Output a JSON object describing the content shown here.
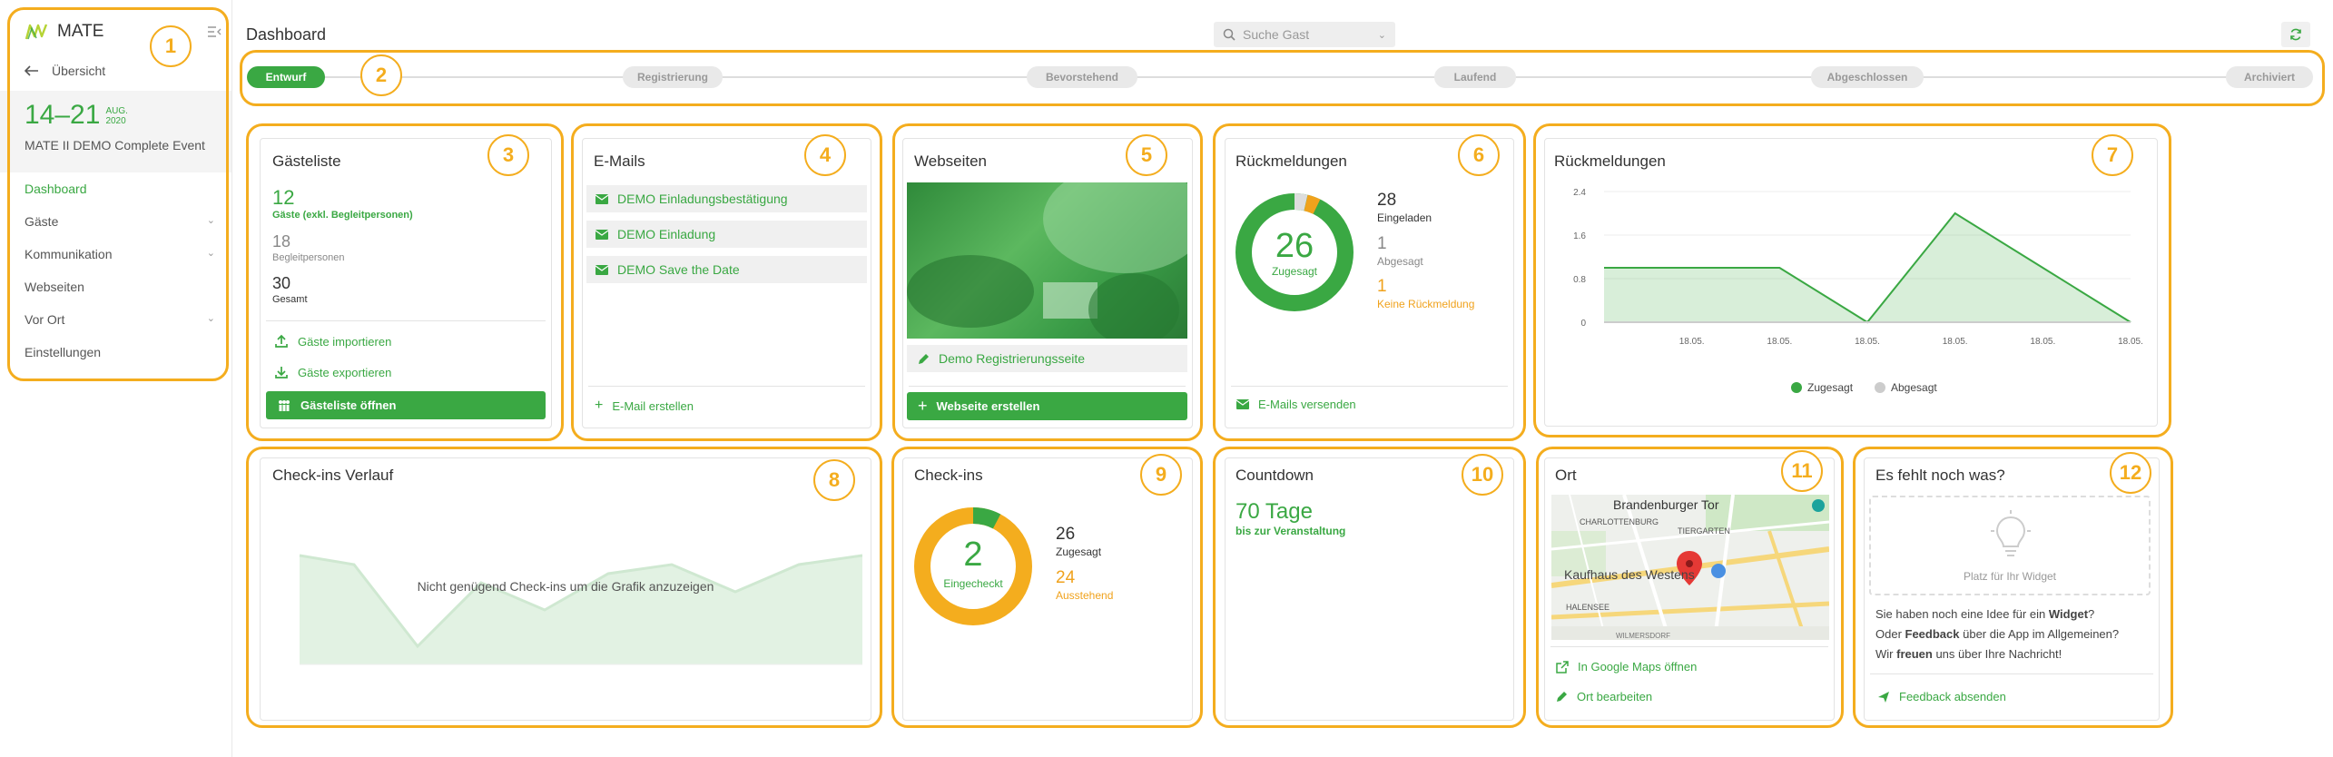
{
  "sidebar": {
    "logo_text": "MATE",
    "back_label": "Übersicht",
    "date_range": "14–21",
    "date_month": "AUG.",
    "date_year": "2020",
    "event_name": "MATE II DEMO Complete Event",
    "nav": [
      {
        "label": "Dashboard",
        "active": true,
        "expandable": false
      },
      {
        "label": "Gäste",
        "active": false,
        "expandable": true
      },
      {
        "label": "Kommunikation",
        "active": false,
        "expandable": true
      },
      {
        "label": "Webseiten",
        "active": false,
        "expandable": false
      },
      {
        "label": "Vor Ort",
        "active": false,
        "expandable": true
      },
      {
        "label": "Einstellungen",
        "active": false,
        "expandable": false
      }
    ]
  },
  "header": {
    "title": "Dashboard",
    "search_placeholder": "Suche Gast"
  },
  "stepper": [
    "Entwurf",
    "Registrierung",
    "Bevorstehend",
    "Laufend",
    "Abgeschlossen",
    "Archiviert"
  ],
  "callouts": [
    "1",
    "2",
    "3",
    "4",
    "5",
    "6",
    "7",
    "8",
    "9",
    "10",
    "11",
    "12"
  ],
  "guests": {
    "title": "Gästeliste",
    "guest_count": "12",
    "guest_label": "Gäste (exkl. Begleitpersonen)",
    "companion_count": "18",
    "companion_label": "Begleitpersonen",
    "total_count": "30",
    "total_label": "Gesamt",
    "import_label": "Gäste importieren",
    "export_label": "Gäste exportieren",
    "open_label": "Gästeliste öffnen"
  },
  "emails": {
    "title": "E-Mails",
    "items": [
      "DEMO Einladungsbestätigung",
      "DEMO Einladung",
      "DEMO Save the Date"
    ],
    "create_label": "E-Mail erstellen"
  },
  "websites": {
    "title": "Webseiten",
    "page_label": "Demo Registrierungsseite",
    "create_label": "Webseite erstellen"
  },
  "rsvp": {
    "title": "Rückmeldungen",
    "accepted": "26",
    "accepted_label": "Zugesagt",
    "invited": "28",
    "invited_label": "Eingeladen",
    "declined": "1",
    "declined_label": "Abgesagt",
    "pending": "1",
    "pending_label": "Keine Rückmeldung",
    "send_label": "E-Mails versenden"
  },
  "rsvp_chart": {
    "title": "Rückmeldungen",
    "legend_accepted": "Zugesagt",
    "legend_declined": "Abgesagt",
    "yticks": [
      "2.4",
      "1.6",
      "0.8",
      "0"
    ]
  },
  "chart_data": {
    "type": "area",
    "title": "Rückmeldungen",
    "x": [
      "",
      "18.05.",
      "18.05.",
      "18.05.",
      "18.05.",
      "18.05.",
      "18.05."
    ],
    "ylim": [
      0,
      2.4
    ],
    "series": [
      {
        "name": "Zugesagt",
        "values": [
          1,
          1,
          1,
          0,
          2,
          1,
          0
        ],
        "color": "#3aa843"
      },
      {
        "name": "Abgesagt",
        "values": [
          0,
          0,
          0,
          0,
          0,
          0,
          0
        ],
        "color": "#cccccc"
      }
    ],
    "legend": "bottom",
    "grid": true
  },
  "checkin_history": {
    "title": "Check-ins Verlauf",
    "empty_message": "Nicht genügend Check-ins um die Grafik anzuzeigen"
  },
  "checkins": {
    "title": "Check-ins",
    "checked_in": "2",
    "checked_in_label": "Eingecheckt",
    "accepted": "26",
    "accepted_label": "Zugesagt",
    "outstanding": "24",
    "outstanding_label": "Ausstehend",
    "progress_fraction": 0.0769
  },
  "countdown": {
    "title": "Countdown",
    "value": "70 Tage",
    "sub": "bis zur Veranstaltung"
  },
  "location": {
    "title": "Ort",
    "map_labels": [
      "Brandenburger Tor",
      "CHARLOTTENBURG",
      "TIERGARTEN",
      "Kaufhaus des Westens",
      "HALENSEE",
      "WILMERSDORF"
    ],
    "open_maps_label": "In Google Maps öffnen",
    "edit_label": "Ort bearbeiten"
  },
  "feedback": {
    "title": "Es fehlt noch was?",
    "placeholder_label": "Platz für Ihr Widget",
    "text_1a": "Sie haben noch eine Idee für ein ",
    "text_1b": "Widget",
    "text_1c": "?",
    "text_2a": "Oder ",
    "text_2b": "Feedback",
    "text_2c": " über die App im Allgemeinen?",
    "text_3a": "Wir ",
    "text_3b": "freuen",
    "text_3c": " uns über Ihre Nachricht!",
    "send_label": "Feedback absenden"
  },
  "colors": {
    "accent": "#3aa843",
    "callout": "#f4ad1e",
    "pending": "#f0a21c"
  }
}
